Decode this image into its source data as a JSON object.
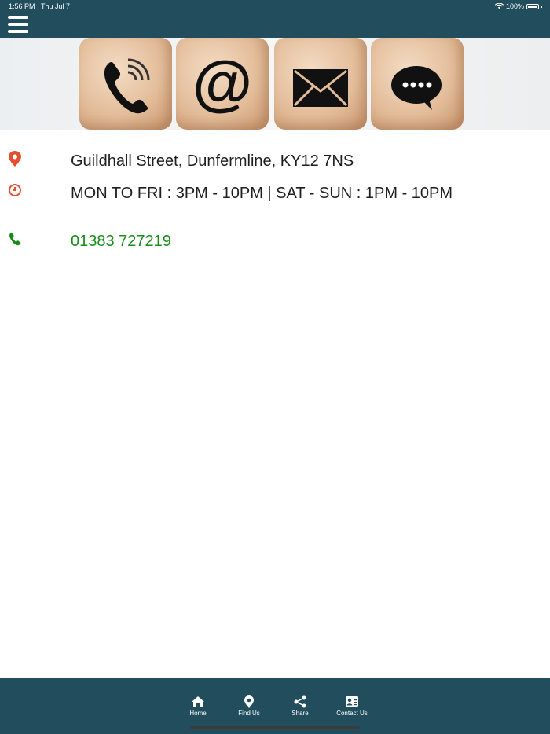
{
  "status_bar": {
    "time": "1:56 PM",
    "date": "Thu Jul 7",
    "battery": "100%"
  },
  "banner": {
    "icons": [
      "phone-icon",
      "at-sign-icon",
      "envelope-icon",
      "chat-bubble-icon"
    ]
  },
  "contact": {
    "address": "Guildhall Street, Dunfermline, KY12 7NS",
    "hours": "MON TO FRI : 3PM - 10PM | SAT - SUN : 1PM - 10PM",
    "phone": "01383 727219"
  },
  "colors": {
    "header": "#214d5d",
    "icon_accent": "#e2502f",
    "phone": "#1a8a1a"
  },
  "tabs": [
    {
      "label": "Home",
      "icon": "home-icon"
    },
    {
      "label": "Find Us",
      "icon": "location-pin-icon"
    },
    {
      "label": "Share",
      "icon": "share-icon"
    },
    {
      "label": "Contact Us",
      "icon": "contact-card-icon"
    }
  ]
}
